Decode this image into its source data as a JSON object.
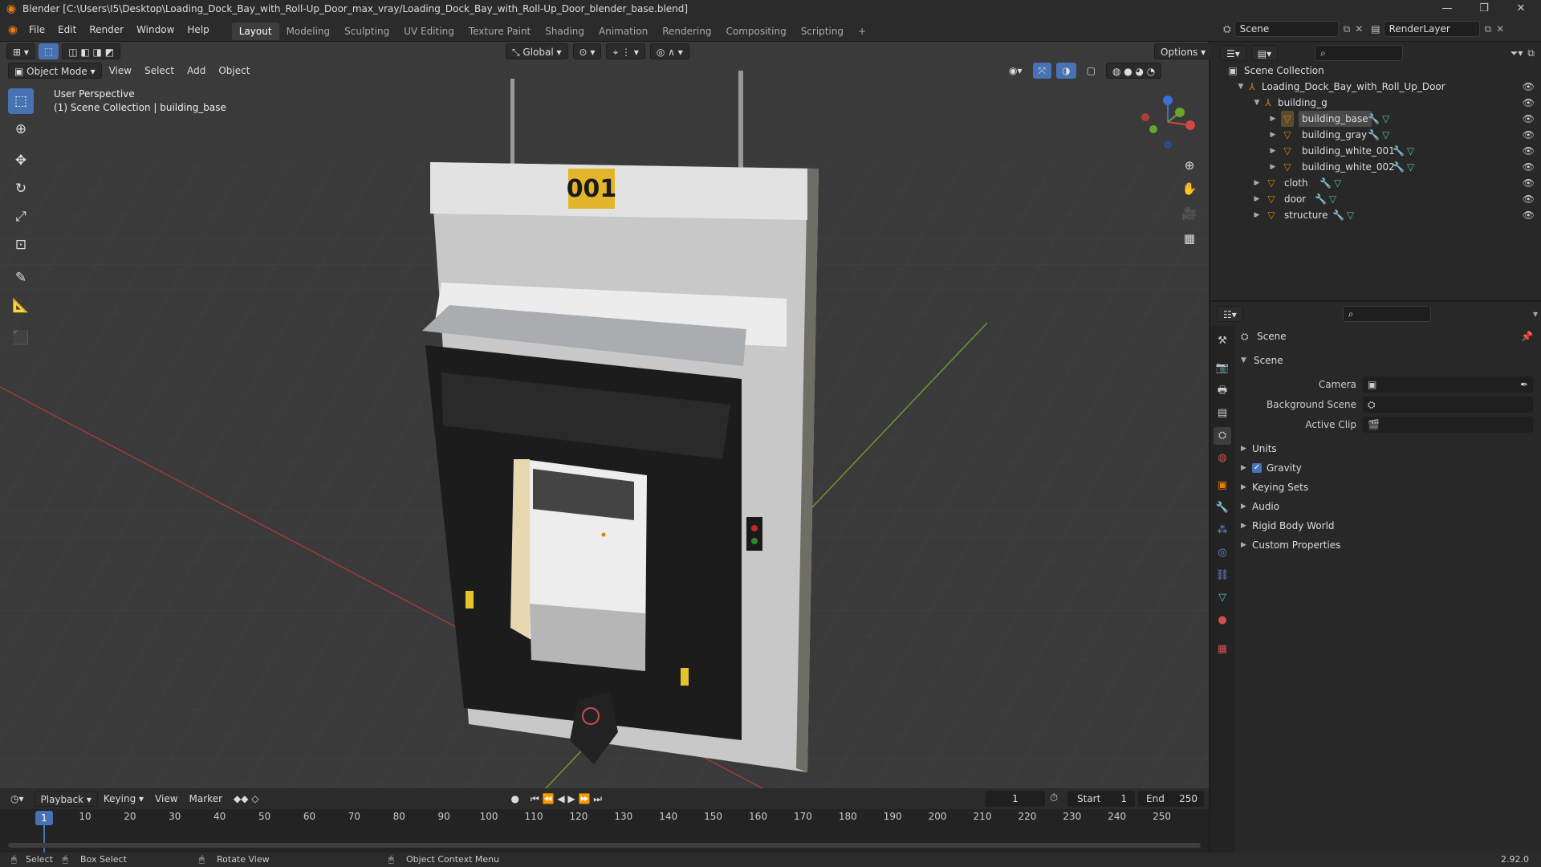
{
  "window": {
    "title": "Blender [C:\\Users\\I5\\Desktop\\Loading_Dock_Bay_with_Roll-Up_Door_max_vray/Loading_Dock_Bay_with_Roll-Up_Door_blender_base.blend]",
    "controls": [
      "—",
      "❐",
      "✕"
    ]
  },
  "menu": [
    "File",
    "Edit",
    "Render",
    "Window",
    "Help"
  ],
  "workspaces": [
    {
      "label": "Layout",
      "active": true
    },
    {
      "label": "Modeling"
    },
    {
      "label": "Sculpting"
    },
    {
      "label": "UV Editing"
    },
    {
      "label": "Texture Paint"
    },
    {
      "label": "Shading"
    },
    {
      "label": "Animation"
    },
    {
      "label": "Rendering"
    },
    {
      "label": "Compositing"
    },
    {
      "label": "Scripting"
    },
    {
      "label": "+"
    }
  ],
  "scene_field": "Scene",
  "renderlayer_field": "RenderLayer",
  "viewport": {
    "transform_orientation": "Global",
    "options_label": "Options",
    "mode": "Object Mode",
    "menus": [
      "View",
      "Select",
      "Add",
      "Object"
    ],
    "perspective_text": "User Perspective",
    "collection_text": "(1) Scene Collection | building_base",
    "sign_number": "001"
  },
  "outliner": {
    "root": "Scene Collection",
    "items": [
      {
        "label": "Loading_Dock_Bay_with_Roll_Up_Door",
        "indent": 1,
        "expanded": true,
        "icon": "collection"
      },
      {
        "label": "building_g",
        "indent": 2,
        "expanded": true,
        "icon": "empty"
      },
      {
        "label": "building_base",
        "indent": 3,
        "icon": "mesh",
        "selected": true
      },
      {
        "label": "building_gray",
        "indent": 3,
        "icon": "mesh"
      },
      {
        "label": "building_white_001",
        "indent": 3,
        "icon": "mesh"
      },
      {
        "label": "building_white_002",
        "indent": 3,
        "icon": "mesh"
      },
      {
        "label": "cloth",
        "indent": 2,
        "icon": "mesh"
      },
      {
        "label": "door",
        "indent": 2,
        "icon": "mesh"
      },
      {
        "label": "structure",
        "indent": 2,
        "icon": "mesh"
      }
    ]
  },
  "properties": {
    "context": "Scene",
    "panel_title": "Scene",
    "fields": [
      {
        "label": "Camera"
      },
      {
        "label": "Background Scene"
      },
      {
        "label": "Active Clip"
      }
    ],
    "subpanels": [
      {
        "label": "Units"
      },
      {
        "label": "Gravity",
        "checked": true
      },
      {
        "label": "Keying Sets"
      },
      {
        "label": "Audio"
      },
      {
        "label": "Rigid Body World"
      },
      {
        "label": "Custom Properties"
      }
    ]
  },
  "timeline": {
    "menus": [
      "Playback",
      "Keying",
      "View",
      "Marker"
    ],
    "current_frame": "1",
    "start_label": "Start",
    "start_value": "1",
    "end_label": "End",
    "end_value": "250",
    "ticks": [
      "10",
      "20",
      "30",
      "40",
      "50",
      "60",
      "70",
      "80",
      "90",
      "100",
      "110",
      "120",
      "130",
      "140",
      "150",
      "160",
      "170",
      "180",
      "190",
      "200",
      "210",
      "220",
      "230",
      "240",
      "250"
    ],
    "playhead_label": "1"
  },
  "statusbar": {
    "select": "Select",
    "box_select": "Box Select",
    "rotate_view": "Rotate View",
    "context_menu": "Object Context Menu",
    "version": "2.92.0"
  },
  "colors": {
    "accent": "#4772b3",
    "sign_yellow": "#e3b52a",
    "mesh_orange": "#e87d0d"
  }
}
